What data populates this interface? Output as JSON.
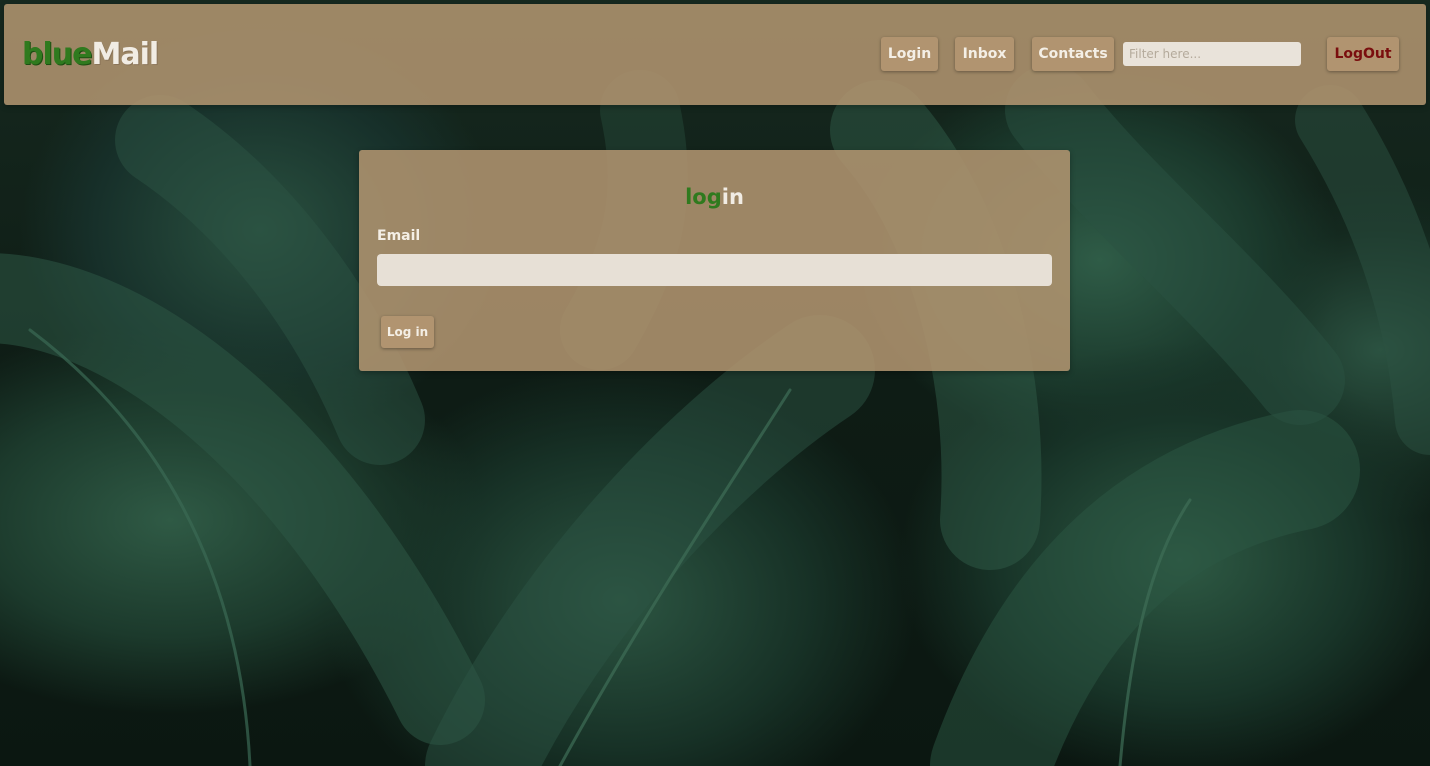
{
  "header": {
    "logo_part1": "blue",
    "logo_part2": "Mail",
    "nav": {
      "login": "Login",
      "inbox": "Inbox",
      "contacts": "Contacts",
      "logout": "LogOut"
    },
    "filter_placeholder": "Filter here...",
    "filter_value": ""
  },
  "login_form": {
    "title_part1": "log",
    "title_part2": "in",
    "email_label": "Email",
    "email_value": "",
    "submit_label": "Log in"
  },
  "colors": {
    "panel": "#b09470",
    "brand_green": "#2f7a1e",
    "logout_red": "#7a0e0e",
    "text_light": "#f4efe6"
  }
}
